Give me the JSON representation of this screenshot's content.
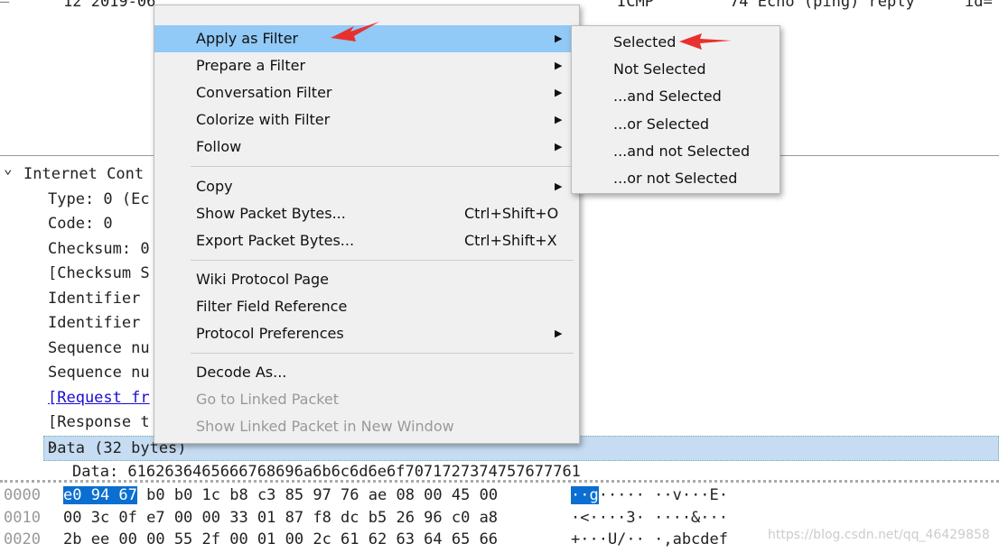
{
  "packet_list": {
    "row": {
      "no_time": "12 2019-06",
      "protocol": "ICMP",
      "info": "74 Echo (ping) reply",
      "extra": "id="
    }
  },
  "tree": {
    "items": [
      {
        "label": "Internet Cont",
        "expanded": true,
        "level": 0
      },
      {
        "label": "Type: 0 (Ec",
        "level": 1
      },
      {
        "label": "Code: 0",
        "level": 1
      },
      {
        "label": "Checksum: 0",
        "level": 1
      },
      {
        "label": "[Checksum S",
        "level": 1
      },
      {
        "label": "Identifier",
        "level": 1
      },
      {
        "label": "Identifier",
        "level": 1
      },
      {
        "label": "Sequence nu",
        "level": 1
      },
      {
        "label": "Sequence nu",
        "level": 1
      },
      {
        "label": "[Request fr",
        "level": 1,
        "link": true
      },
      {
        "label": "[Response t",
        "level": 1
      },
      {
        "label": "Data (32 bytes)",
        "expanded": true,
        "level": 0,
        "selected": true
      },
      {
        "label": "Data: 6162636465666768696a6b6c6d6e6f7071727374757677761",
        "level": 1
      }
    ]
  },
  "hex": {
    "rows": [
      {
        "offset": "0000",
        "bytes_sel": "e0 94 67",
        "bytes": " b0 b0 1c b8 c3  85 97 76 ae 08 00 45 00",
        "ascii_sel": "··g",
        "ascii": "·····  ··v···E·"
      },
      {
        "offset": "0010",
        "bytes_sel": "",
        "bytes": "00 3c 0f e7 00 00 33 01  87 f8 dc b5 26 96 c0 a8",
        "ascii_sel": "",
        "ascii": "·<····3·  ····&···"
      },
      {
        "offset": "0020",
        "bytes_sel": "",
        "bytes": "2b ee 00 00 55 2f 00 01  00 2c 61 62 63 64 65 66",
        "ascii_sel": "",
        "ascii": "+···U/··  ·,abcdef"
      }
    ]
  },
  "context_menu": {
    "items": [
      {
        "label": "Apply as Filter",
        "submenu": true,
        "highlighted": true
      },
      {
        "label": "Prepare a Filter",
        "submenu": true
      },
      {
        "label": "Conversation Filter",
        "submenu": true
      },
      {
        "label": "Colorize with Filter",
        "submenu": true
      },
      {
        "label": "Follow",
        "submenu": true
      },
      {
        "label": "Copy",
        "submenu": true
      },
      {
        "label": "Show Packet Bytes...",
        "shortcut": "Ctrl+Shift+O"
      },
      {
        "label": "Export Packet Bytes...",
        "shortcut": "Ctrl+Shift+X"
      },
      {
        "label": "Wiki Protocol Page"
      },
      {
        "label": "Filter Field Reference"
      },
      {
        "label": "Protocol Preferences",
        "submenu": true
      },
      {
        "label": "Decode As..."
      },
      {
        "label": "Go to Linked Packet",
        "disabled": true
      },
      {
        "label": "Show Linked Packet in New Window",
        "disabled": true
      }
    ]
  },
  "submenu": {
    "items": [
      {
        "label": "Selected"
      },
      {
        "label": "Not Selected"
      },
      {
        "label": "...and Selected"
      },
      {
        "label": "...or Selected"
      },
      {
        "label": "...and not Selected"
      },
      {
        "label": "...or not Selected"
      }
    ]
  },
  "watermark": "https://blog.csdn.net/qq_46429858",
  "colors": {
    "highlight": "#91c9f7",
    "selection": "#c5dcf2",
    "hex_selection": "#0a6fd0",
    "annotation_arrow": "#e8312f"
  }
}
